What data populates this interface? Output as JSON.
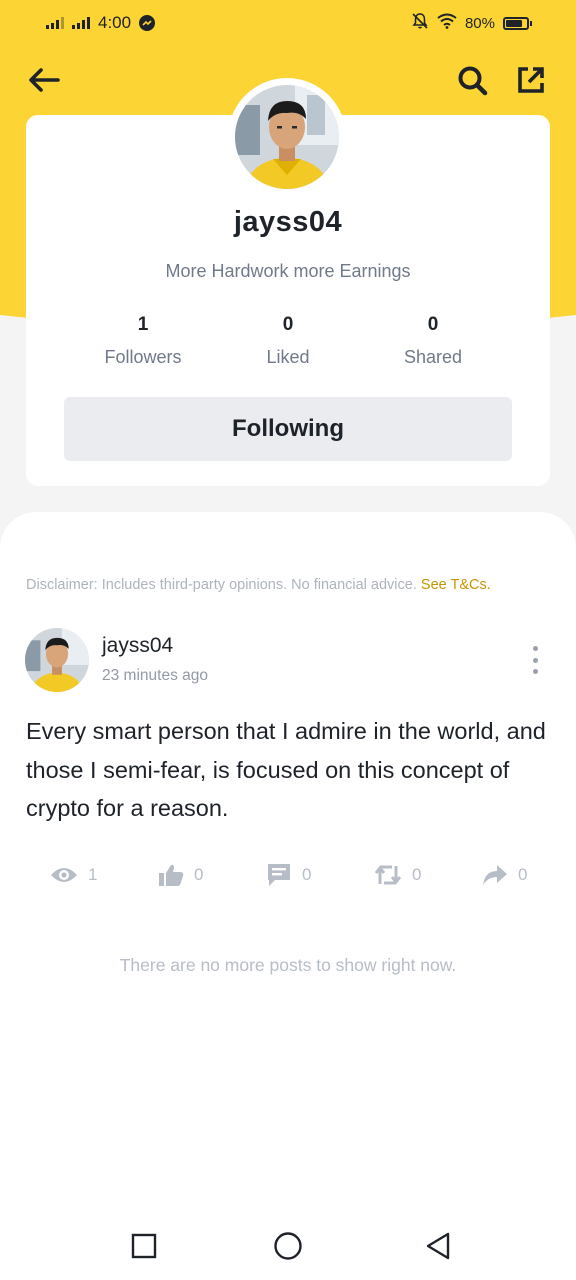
{
  "status_bar": {
    "time": "4:00",
    "battery_text": "80%",
    "battery_level": 0.8
  },
  "header": {
    "icons": [
      "back-arrow-icon",
      "search-icon",
      "share-external-icon"
    ]
  },
  "profile": {
    "username": "jayss04",
    "bio": "More Hardwork more Earnings",
    "stats": [
      {
        "value": "1",
        "label": "Followers"
      },
      {
        "value": "0",
        "label": "Liked"
      },
      {
        "value": "0",
        "label": "Shared"
      }
    ],
    "follow_button": "Following"
  },
  "feed": {
    "disclaimer": "Disclaimer: Includes third-party opinions. No financial advice.",
    "disclaimer_link": "See T&Cs.",
    "post": {
      "author": "jayss04",
      "time": "23 minutes ago",
      "text": "Every smart person that I admire in the world, and those I semi-fear, is focused on this concept of crypto for a reason.",
      "actions": {
        "views": "1",
        "likes": "0",
        "comments": "0",
        "reposts": "0",
        "shares": "0"
      }
    },
    "end_message": "There are no more posts to show right now."
  },
  "colors": {
    "brand_yellow": "#fcd535",
    "link": "#c99400"
  }
}
